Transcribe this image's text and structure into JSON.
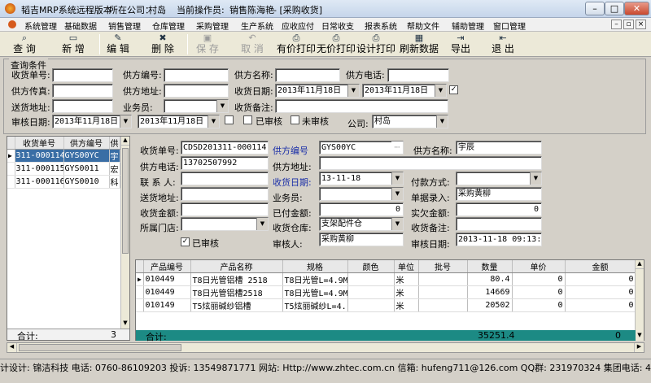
{
  "title": {
    "app": "韬吉MRP系统远程版本",
    "location_label": "所在公司：",
    "location": "村岛",
    "operator_label": "当前操作员:",
    "operator": "销售陈海艳",
    "window": "- [采购收货]"
  },
  "menu": [
    "系统管理",
    "基础数据",
    "销售管理",
    "仓库管理",
    "采购管理",
    "生产系统",
    "应收应付",
    "日常收支",
    "报表系统",
    "帮助文件",
    "辅助管理",
    "窗口管理"
  ],
  "toolbar": [
    {
      "label": "查 询",
      "icon": "search-icon",
      "enabled": true
    },
    {
      "label": "新 增",
      "icon": "new-doc-icon",
      "enabled": true
    },
    {
      "label": "编 辑",
      "icon": "edit-icon",
      "enabled": true
    },
    {
      "label": "删 除",
      "icon": "delete-icon",
      "enabled": true
    },
    {
      "label": "保 存",
      "icon": "save-icon",
      "enabled": false
    },
    {
      "label": "取 消",
      "icon": "undo-icon",
      "enabled": false
    },
    {
      "label": "有价打印",
      "icon": "printer-icon",
      "enabled": true
    },
    {
      "label": "无价打印",
      "icon": "printer-icon",
      "enabled": true
    },
    {
      "label": "设计打印",
      "icon": "printer-icon",
      "enabled": true
    },
    {
      "label": "刷新数据",
      "icon": "refresh-icon",
      "enabled": true
    },
    {
      "label": "导出",
      "icon": "export-icon",
      "enabled": true
    },
    {
      "label": "退 出",
      "icon": "exit-icon",
      "enabled": true
    }
  ],
  "query": {
    "group_title": "查询条件",
    "receipt_no": "收货单号:",
    "supplier_no": "供方编号:",
    "supplier_name": "供方名称:",
    "supplier_phone": "供方电话:",
    "supplier_fax": "供方传真:",
    "supplier_address": "供方地址:",
    "receipt_date": "收货日期:",
    "date_from": "2013年11月18日",
    "date_to": "2013年11月18日",
    "delivery_address": "送货地址:",
    "salesman": "业务员:",
    "remark": "收货备注:",
    "audit_date": "审核日期:",
    "audit_from": "2013年11月18日",
    "audit_to": "2013年11月18日",
    "audited": "已审核",
    "unaudited": "未审核",
    "company_label": "公司:",
    "company": "村岛"
  },
  "list": {
    "headers": [
      "收货单号",
      "供方编号",
      "供"
    ],
    "rows": [
      [
        "311-000114",
        "GYS00YC",
        "宇"
      ],
      [
        "311-000115",
        "GYS0011",
        "宏"
      ],
      [
        "311-000116",
        "GYS0010",
        "科"
      ]
    ],
    "total_label": "合计:",
    "total": "3"
  },
  "detail": {
    "receipt_no_label": "收货单号:",
    "receipt_no": "CDSD201311-000114",
    "supplier_no_label": "供方编号",
    "supplier_no": "GYS00YC",
    "supplier_name_label": "供方名称:",
    "supplier_name": "宇辰",
    "supplier_phone_label": "供方电话:",
    "supplier_phone": "13702507992",
    "supplier_address_label": "供方地址:",
    "supplier_address": "",
    "contact_label": "联 系 人:",
    "contact": "",
    "receipt_date_label": "收货日期:",
    "receipt_date": "13-11-18",
    "payment_label": "付款方式:",
    "payment": "",
    "delivery_label": "送货地址:",
    "delivery": "",
    "salesman_label": "业务员:",
    "salesman": "",
    "entry_label": "单据录入:",
    "entry": "采购黄柳",
    "amount_label": "收货金额:",
    "amount": "",
    "paid_label": "已付金额:",
    "paid": "0",
    "actual_label": "实欠金额:",
    "actual": "0",
    "store_label": "所属门店:",
    "store": "",
    "warehouse_label": "收货仓库:",
    "warehouse": "支架配件仓",
    "remark_label": "收货备注:",
    "remark": "",
    "audited_label": "已审核",
    "auditor_label": "审核人:",
    "auditor": "采购黄柳",
    "audit_date_label": "审核日期:",
    "audit_date": "2013-11-18 09:13:00"
  },
  "items": {
    "headers": [
      "产品编号",
      "产品名称",
      "规格",
      "颜色",
      "单位",
      "批号",
      "数量",
      "单价",
      "金额"
    ],
    "rows": [
      [
        "010449",
        "T8日光管铝槽  2518",
        "T8日光管L=4.9M",
        "",
        "米",
        "",
        "80.4",
        "0",
        "0"
      ],
      [
        "010449",
        "T8日光管铝槽2518",
        "T8日光管L=4.9M",
        "",
        "米",
        "",
        "14669",
        "0",
        "0"
      ],
      [
        "010149",
        "T5炫丽碱纱铝槽",
        "T5炫丽碱纱L=4.",
        "",
        "米",
        "",
        "20502",
        "0",
        "0"
      ]
    ],
    "total_label": "合计:",
    "total_qty": "35251.4",
    "total_amount": "0"
  },
  "status": "计设计: 锦洁科技 电话: 0760-86109203  投诉: 13549871771 网站: Http://www.zhtec.com.cn 信箱: hufeng711@126.com QQ群: 231970324 集团电话: 400-0760-"
}
